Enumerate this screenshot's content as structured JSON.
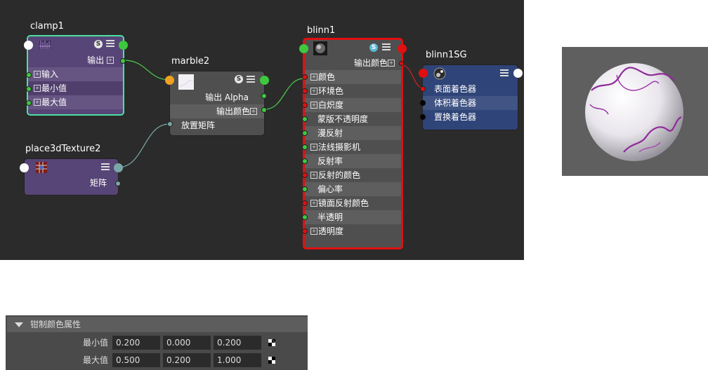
{
  "nodes": {
    "clamp1": {
      "title": "clamp1",
      "output_label": "输出",
      "rows": [
        "输入",
        "最小值",
        "最大值"
      ]
    },
    "marble2": {
      "title": "marble2",
      "rows": [
        "输出 Alpha",
        "输出颜色",
        "放置矩阵"
      ]
    },
    "place3d": {
      "title": "place3dTexture2",
      "output_label": "矩阵"
    },
    "blinn1": {
      "title": "blinn1",
      "output_label": "输出颜色",
      "rows": [
        "颜色",
        "环境色",
        "白炽度",
        "蒙版不透明度",
        "漫反射",
        "法线摄影机",
        "反射率",
        "反射的颜色",
        "偏心率",
        "镜面反射颜色",
        "半透明",
        "透明度"
      ]
    },
    "blinn1SG": {
      "title": "blinn1SG",
      "rows": [
        "表面着色器",
        "体积着色器",
        "置换着色器"
      ]
    }
  },
  "badge_letter": "S",
  "panel": {
    "header": "钳制颜色属性",
    "min_label": "最小值",
    "min_values": [
      "0.200",
      "0.000",
      "0.200"
    ],
    "max_label": "最大值",
    "max_values": [
      "0.500",
      "0.200",
      "1.000"
    ]
  },
  "colors": {
    "graph_bg": "#2b2b2b",
    "texture_node": "#574577",
    "utility_node": "#4f4f4f",
    "shading_group_node": "#2f4478",
    "selected_border": "#e01010",
    "clamp_border": "#4de0a0",
    "port_green": "#3ec83e",
    "port_red": "#e01010",
    "port_orange": "#f0a020",
    "port_teal": "#7aa6a6",
    "wire_green": "#4bd04b",
    "wire_teal": "#7aa6a6",
    "wire_red": "#d92020"
  },
  "icons": [
    "clamp-icon",
    "marble-icon",
    "place3d-icon",
    "blinn-sphere-icon",
    "shading-group-icon",
    "solo-badge-icon",
    "attribute-menu-icon",
    "expand-plus-icon",
    "checker-map-icon",
    "collapse-arrow-icon"
  ]
}
